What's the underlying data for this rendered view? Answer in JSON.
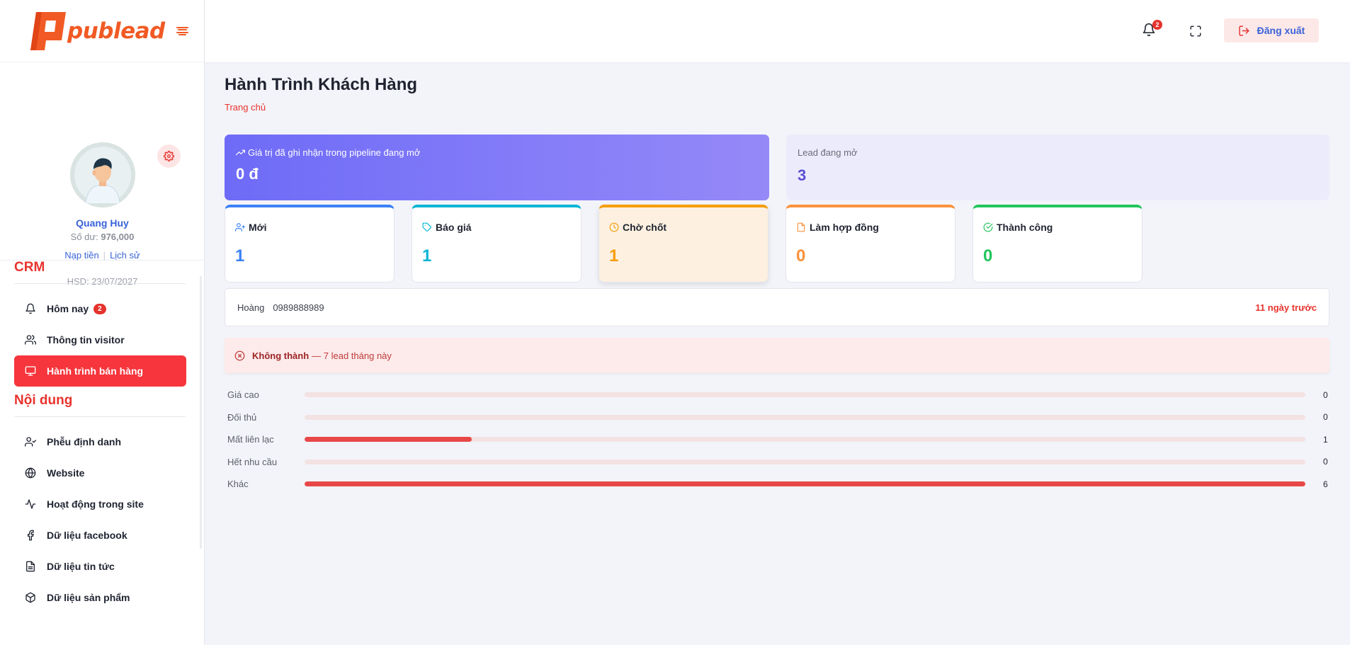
{
  "brand": {
    "logo_text": "publead",
    "accent": "#f15a24"
  },
  "profile": {
    "name": "Quang Huy",
    "balance_label": "Số dư:",
    "balance_value": "976,000",
    "topup_link": "Nạp tiền",
    "history_link": "Lịch sử",
    "expiry": "HSD: 23/07/2027"
  },
  "sidebar": {
    "sections": [
      {
        "title": "CRM",
        "items": [
          {
            "label": "Hôm nay",
            "icon": "bell-icon",
            "badge": "2",
            "active": false
          },
          {
            "label": "Thông tin visitor",
            "icon": "users-icon",
            "active": false
          },
          {
            "label": "Hành trình bán hàng",
            "icon": "monitor-icon",
            "active": true
          }
        ]
      },
      {
        "title": "Nội dung",
        "items": [
          {
            "label": "Phễu định danh",
            "icon": "user-check-icon",
            "active": false
          },
          {
            "label": "Website",
            "icon": "globe-icon",
            "active": false
          },
          {
            "label": "Hoạt động trong site",
            "icon": "activity-icon",
            "active": false
          },
          {
            "label": "Dữ liệu facebook",
            "icon": "facebook-icon",
            "active": false
          },
          {
            "label": "Dữ liệu tin tức",
            "icon": "file-text-icon",
            "active": false
          },
          {
            "label": "Dữ liệu sản phẩm",
            "icon": "box-icon",
            "active": false
          }
        ]
      }
    ]
  },
  "topbar": {
    "notification_count": "2",
    "logout_label": "Đăng xuất"
  },
  "page": {
    "title": "Hành Trình Khách Hàng",
    "breadcrumb": "Trang chủ"
  },
  "summary": {
    "pipeline_label": "Giá trị đã ghi nhận trong pipeline đang mở",
    "pipeline_value": "0 đ",
    "leads_open_label": "Lead đang mở",
    "leads_open_value": "3"
  },
  "stages": [
    {
      "label": "Mới",
      "count": "1",
      "color": "#3b82f6",
      "icon": "user-plus-icon",
      "highlight": false
    },
    {
      "label": "Báo giá",
      "count": "1",
      "color": "#06b6d4",
      "icon": "tag-icon",
      "highlight": false
    },
    {
      "label": "Chờ chốt",
      "count": "1",
      "color": "#f59e0b",
      "icon": "clock-icon",
      "highlight": true
    },
    {
      "label": "Làm hợp đồng",
      "count": "0",
      "color": "#fb923c",
      "icon": "file-icon",
      "highlight": false
    },
    {
      "label": "Thành công",
      "count": "0",
      "color": "#22c55e",
      "icon": "check-circle-icon",
      "highlight": false
    }
  ],
  "lead_row": {
    "name": "Hoàng",
    "phone": "0989888989",
    "time": "11 ngày trước"
  },
  "lost": {
    "title": "Không thành",
    "subtitle": "— 7 lead tháng này",
    "reasons": [
      {
        "label": "Giá cao",
        "count": 0
      },
      {
        "label": "Đối thủ",
        "count": 0
      },
      {
        "label": "Mất liên lạc",
        "count": 1
      },
      {
        "label": "Hết nhu cầu",
        "count": 0
      },
      {
        "label": "Khác",
        "count": 6
      }
    ]
  }
}
